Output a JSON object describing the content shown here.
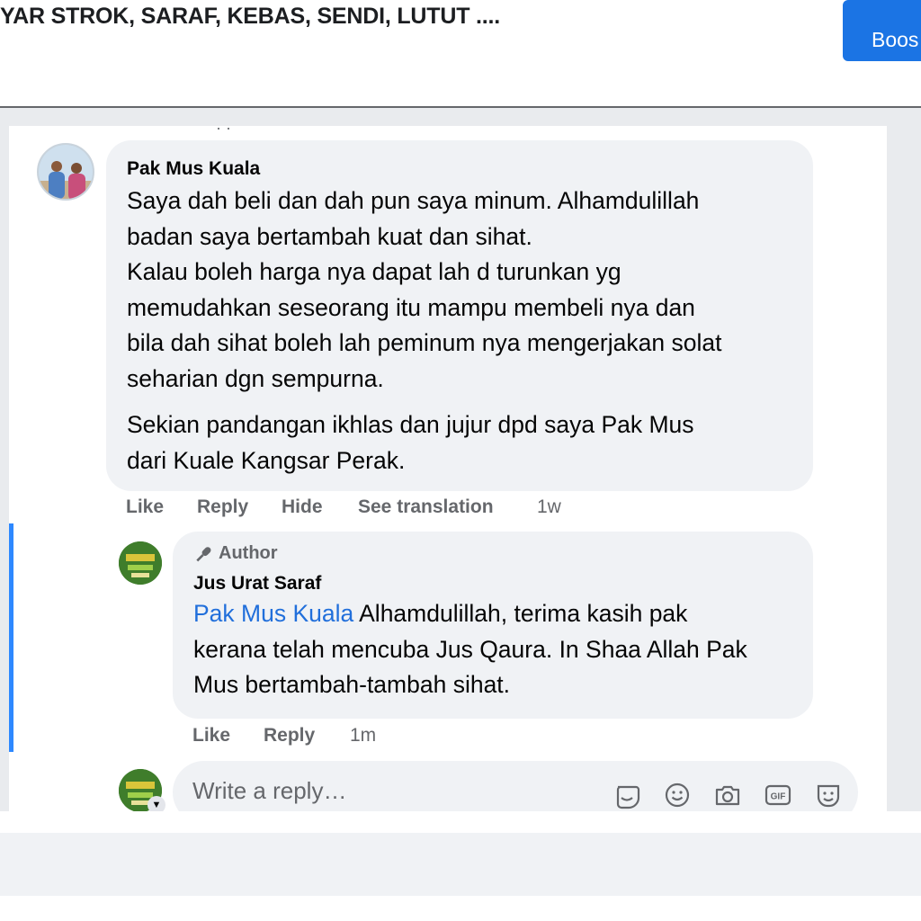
{
  "post": {
    "title": "YAR STROK, SARAF, KEBAS, SENDI, LUTUT ....",
    "boost_label": "Boos"
  },
  "comment": {
    "author": "Pak Mus Kuala",
    "paragraphs": [
      [
        "Saya dah beli dan dah pun saya minum. Alhamdulillah",
        "badan saya bertambah kuat dan sihat.",
        "Kalau boleh harga nya dapat lah d turunkan yg",
        "memudahkan seseorang itu mampu membeli nya dan",
        "bila dah sihat boleh lah peminum nya mengerjakan solat",
        "seharian dgn sempurna."
      ],
      [
        "Sekian pandangan ikhlas dan jujur dpd saya Pak Mus",
        "dari Kuale Kangsar Perak."
      ]
    ],
    "actions": {
      "like": "Like",
      "reply": "Reply",
      "hide": "Hide",
      "translate": "See translation",
      "time": "1w"
    }
  },
  "reply": {
    "badge": "Author",
    "author": "Jus Urat Saraf",
    "mention": "Pak Mus Kuala",
    "lines": [
      " Alhamdulillah, terima kasih pak",
      "kerana telah mencuba Jus Qaura. In Shaa Allah Pak",
      "Mus bertambah-tambah sihat."
    ],
    "actions": {
      "like": "Like",
      "reply": "Reply",
      "time": "1m"
    }
  },
  "composer": {
    "placeholder": "Write a reply…",
    "icons": [
      "sticker-icon",
      "emoji-icon",
      "camera-icon",
      "gif-icon",
      "avatar-sticker-icon"
    ]
  },
  "colors": {
    "accent": "#1b74e4",
    "mention": "#216fdb",
    "bubble": "#f0f2f5",
    "thread_line": "#2d88ff"
  }
}
